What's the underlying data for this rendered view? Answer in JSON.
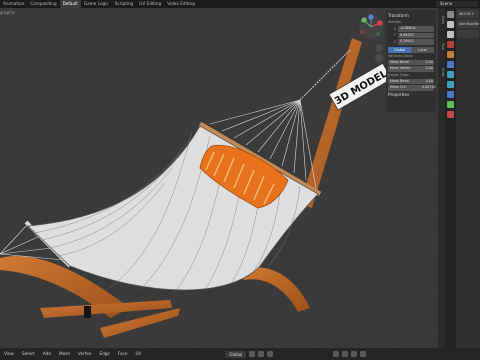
{
  "topbar": {
    "workspaces": [
      "Animation",
      "Compositing",
      "Default",
      "Game Logic",
      "Scripting",
      "UV Editing",
      "Video Editing"
    ],
    "active_workspace": "Default",
    "scene": "Scene"
  },
  "viewport": {
    "label": "graphic",
    "sign_text": "3D MODEL"
  },
  "npanel": {
    "transform_title": "Transform",
    "median_label": "Median:",
    "axes": [
      {
        "k": "X",
        "v": "-0.08914"
      },
      {
        "k": "Y",
        "v": "0.64322"
      },
      {
        "k": "Z",
        "v": "0.19921"
      }
    ],
    "global_label": "Global",
    "local_label": "Local",
    "vertices_label": "Vertices Data:",
    "mean_bevel_label": "Mean Bevel",
    "mean_bevel_value": "0.00",
    "mean_vertex_label": "Mean Vertex",
    "mean_vertex_value": "0.00",
    "edges_label": "Edges Data:",
    "edge_bevel_label": "Mean Bevel",
    "edge_bevel_value": "0.00",
    "edge_crease_label": "Mean Cre",
    "edge_crease_value": "0.00710",
    "properties_label": "Properties"
  },
  "npanel_tabs": [
    "Item",
    "Tool",
    "View"
  ],
  "props": {
    "rows": [
      "WOOD 3",
      "Add Modifier",
      ""
    ]
  },
  "header": {
    "menus": [
      "View",
      "Select",
      "Add",
      "Mesh",
      "Vertex",
      "Edge",
      "Face",
      "UV"
    ],
    "orientation": "Global"
  },
  "colors": {
    "accent": "#4772b3",
    "wood": "#c06a28",
    "wire": "#2a2a2a",
    "pillow": "#e8731c"
  }
}
